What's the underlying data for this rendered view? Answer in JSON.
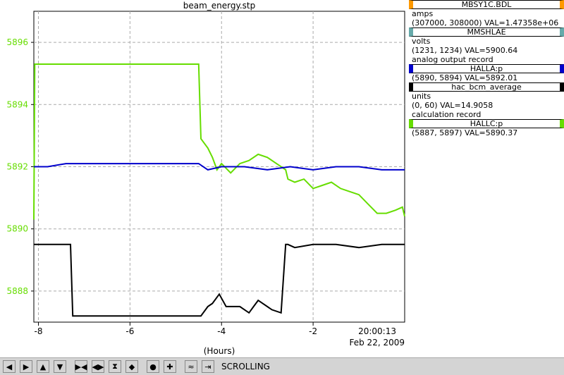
{
  "chart_data": {
    "type": "line",
    "title": "beam_energy.stp",
    "xlabel": "(Hours)",
    "time_label": "20:00:13",
    "date_label": "Feb 22, 2009",
    "xlim": [
      -8.1,
      0.0
    ],
    "ylim": [
      5887,
      5897
    ],
    "grid": true,
    "x_ticks": [
      -8,
      -6,
      -4,
      -2
    ],
    "x_tick_labels": [
      "-8",
      "-6",
      "-4",
      "-2"
    ],
    "y_ticks": [
      5888,
      5890,
      5892,
      5894,
      5896
    ],
    "y_tick_labels": [
      "5888",
      "5890",
      "5892",
      "5894",
      "5896"
    ],
    "series": [
      {
        "name": "HALLC:p",
        "color": "#66dd00",
        "x": [
          -8.1,
          -8.08,
          -8.06,
          -7.4,
          -4.5,
          -4.45,
          -4.3,
          -4.2,
          -4.1,
          -4.0,
          -3.8,
          -3.6,
          -3.4,
          -3.2,
          -3.0,
          -2.8,
          -2.6,
          -2.55,
          -2.4,
          -2.2,
          -2.0,
          -1.8,
          -1.6,
          -1.4,
          -1.2,
          -1.0,
          -0.8,
          -0.6,
          -0.4,
          -0.2,
          -0.05,
          0.0
        ],
        "values": [
          5890.3,
          5895.3,
          5895.3,
          5895.3,
          5895.3,
          5892.9,
          5892.6,
          5892.3,
          5891.9,
          5892.1,
          5891.8,
          5892.1,
          5892.2,
          5892.4,
          5892.3,
          5892.1,
          5891.9,
          5891.6,
          5891.5,
          5891.6,
          5891.3,
          5891.4,
          5891.5,
          5891.3,
          5891.2,
          5891.1,
          5890.8,
          5890.5,
          5890.5,
          5890.6,
          5890.7,
          5890.4
        ]
      },
      {
        "name": "HALLA:p",
        "color": "#0000cc",
        "x": [
          -8.1,
          -7.8,
          -7.4,
          -4.5,
          -4.3,
          -4.0,
          -3.5,
          -3.0,
          -2.5,
          -2.0,
          -1.5,
          -1.0,
          -0.5,
          0.0
        ],
        "values": [
          5892.0,
          5892.0,
          5892.1,
          5892.1,
          5891.9,
          5892.0,
          5892.0,
          5891.9,
          5892.0,
          5891.9,
          5892.0,
          5892.0,
          5891.9,
          5891.9
        ]
      },
      {
        "name": "hac_bcm_average",
        "color": "#000000",
        "x": [
          -8.1,
          -7.3,
          -7.25,
          -4.5,
          -4.45,
          -4.3,
          -4.2,
          -4.05,
          -3.9,
          -3.6,
          -3.4,
          -3.3,
          -3.2,
          -2.9,
          -2.7,
          -2.6,
          -2.55,
          -2.4,
          -2.0,
          -1.5,
          -1.0,
          -0.5,
          0.0
        ],
        "values": [
          5889.5,
          5889.5,
          5887.2,
          5887.2,
          5887.2,
          5887.5,
          5887.6,
          5887.9,
          5887.5,
          5887.5,
          5887.3,
          5887.5,
          5887.7,
          5887.4,
          5887.3,
          5889.5,
          5889.5,
          5889.4,
          5889.5,
          5889.5,
          5889.4,
          5889.5,
          5889.5
        ]
      }
    ]
  },
  "legend": [
    {
      "name": "MBSY1C.BDL",
      "color": "#ff9900",
      "lines": [
        "amps",
        "(307000, 308000)  VAL=1.47358e+06"
      ]
    },
    {
      "name": "MMSHLAE",
      "color": "#66aaaa",
      "lines": [
        "volts",
        "(1231, 1234)  VAL=5900.64",
        "analog output record"
      ]
    },
    {
      "name": "HALLA:p",
      "color": "#0000cc",
      "lines": [
        "(5890, 5894) VAL=5892.01"
      ]
    },
    {
      "name": "hac_bcm_average",
      "color": "#000000",
      "lines": [
        "units",
        "(0, 60) VAL=14.9058",
        "calculation record"
      ]
    },
    {
      "name": "HALLC:p",
      "color": "#66dd00",
      "lines": [
        "(5887, 5897) VAL=5890.37"
      ]
    }
  ],
  "toolbar": {
    "buttons": [
      "scroll-left-icon",
      "scroll-right-icon",
      "scroll-up-icon",
      "scroll-down-icon",
      "zoom-in-horizontal-icon",
      "zoom-out-horizontal-icon",
      "zoom-in-vertical-icon",
      "zoom-out-vertical-icon",
      "auto-scale-icon",
      "add-channel-icon",
      "pan-icon",
      "export-icon"
    ],
    "mode_label": "SCROLLING"
  }
}
